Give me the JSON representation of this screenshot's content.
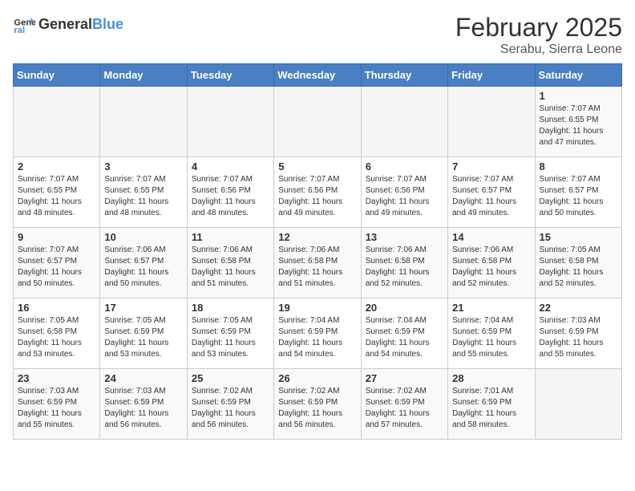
{
  "header": {
    "logo_general": "General",
    "logo_blue": "Blue",
    "month_year": "February 2025",
    "location": "Serabu, Sierra Leone"
  },
  "days_of_week": [
    "Sunday",
    "Monday",
    "Tuesday",
    "Wednesday",
    "Thursday",
    "Friday",
    "Saturday"
  ],
  "weeks": [
    [
      {
        "day": "",
        "sunrise": "",
        "sunset": "",
        "daylight": ""
      },
      {
        "day": "",
        "sunrise": "",
        "sunset": "",
        "daylight": ""
      },
      {
        "day": "",
        "sunrise": "",
        "sunset": "",
        "daylight": ""
      },
      {
        "day": "",
        "sunrise": "",
        "sunset": "",
        "daylight": ""
      },
      {
        "day": "",
        "sunrise": "",
        "sunset": "",
        "daylight": ""
      },
      {
        "day": "",
        "sunrise": "",
        "sunset": "",
        "daylight": ""
      },
      {
        "day": "1",
        "sunrise": "Sunrise: 7:07 AM",
        "sunset": "Sunset: 6:55 PM",
        "daylight": "Daylight: 11 hours and 47 minutes."
      }
    ],
    [
      {
        "day": "2",
        "sunrise": "Sunrise: 7:07 AM",
        "sunset": "Sunset: 6:55 PM",
        "daylight": "Daylight: 11 hours and 48 minutes."
      },
      {
        "day": "3",
        "sunrise": "Sunrise: 7:07 AM",
        "sunset": "Sunset: 6:55 PM",
        "daylight": "Daylight: 11 hours and 48 minutes."
      },
      {
        "day": "4",
        "sunrise": "Sunrise: 7:07 AM",
        "sunset": "Sunset: 6:56 PM",
        "daylight": "Daylight: 11 hours and 48 minutes."
      },
      {
        "day": "5",
        "sunrise": "Sunrise: 7:07 AM",
        "sunset": "Sunset: 6:56 PM",
        "daylight": "Daylight: 11 hours and 49 minutes."
      },
      {
        "day": "6",
        "sunrise": "Sunrise: 7:07 AM",
        "sunset": "Sunset: 6:56 PM",
        "daylight": "Daylight: 11 hours and 49 minutes."
      },
      {
        "day": "7",
        "sunrise": "Sunrise: 7:07 AM",
        "sunset": "Sunset: 6:57 PM",
        "daylight": "Daylight: 11 hours and 49 minutes."
      },
      {
        "day": "8",
        "sunrise": "Sunrise: 7:07 AM",
        "sunset": "Sunset: 6:57 PM",
        "daylight": "Daylight: 11 hours and 50 minutes."
      }
    ],
    [
      {
        "day": "9",
        "sunrise": "Sunrise: 7:07 AM",
        "sunset": "Sunset: 6:57 PM",
        "daylight": "Daylight: 11 hours and 50 minutes."
      },
      {
        "day": "10",
        "sunrise": "Sunrise: 7:06 AM",
        "sunset": "Sunset: 6:57 PM",
        "daylight": "Daylight: 11 hours and 50 minutes."
      },
      {
        "day": "11",
        "sunrise": "Sunrise: 7:06 AM",
        "sunset": "Sunset: 6:58 PM",
        "daylight": "Daylight: 11 hours and 51 minutes."
      },
      {
        "day": "12",
        "sunrise": "Sunrise: 7:06 AM",
        "sunset": "Sunset: 6:58 PM",
        "daylight": "Daylight: 11 hours and 51 minutes."
      },
      {
        "day": "13",
        "sunrise": "Sunrise: 7:06 AM",
        "sunset": "Sunset: 6:58 PM",
        "daylight": "Daylight: 11 hours and 52 minutes."
      },
      {
        "day": "14",
        "sunrise": "Sunrise: 7:06 AM",
        "sunset": "Sunset: 6:58 PM",
        "daylight": "Daylight: 11 hours and 52 minutes."
      },
      {
        "day": "15",
        "sunrise": "Sunrise: 7:05 AM",
        "sunset": "Sunset: 6:58 PM",
        "daylight": "Daylight: 11 hours and 52 minutes."
      }
    ],
    [
      {
        "day": "16",
        "sunrise": "Sunrise: 7:05 AM",
        "sunset": "Sunset: 6:58 PM",
        "daylight": "Daylight: 11 hours and 53 minutes."
      },
      {
        "day": "17",
        "sunrise": "Sunrise: 7:05 AM",
        "sunset": "Sunset: 6:59 PM",
        "daylight": "Daylight: 11 hours and 53 minutes."
      },
      {
        "day": "18",
        "sunrise": "Sunrise: 7:05 AM",
        "sunset": "Sunset: 6:59 PM",
        "daylight": "Daylight: 11 hours and 53 minutes."
      },
      {
        "day": "19",
        "sunrise": "Sunrise: 7:04 AM",
        "sunset": "Sunset: 6:59 PM",
        "daylight": "Daylight: 11 hours and 54 minutes."
      },
      {
        "day": "20",
        "sunrise": "Sunrise: 7:04 AM",
        "sunset": "Sunset: 6:59 PM",
        "daylight": "Daylight: 11 hours and 54 minutes."
      },
      {
        "day": "21",
        "sunrise": "Sunrise: 7:04 AM",
        "sunset": "Sunset: 6:59 PM",
        "daylight": "Daylight: 11 hours and 55 minutes."
      },
      {
        "day": "22",
        "sunrise": "Sunrise: 7:03 AM",
        "sunset": "Sunset: 6:59 PM",
        "daylight": "Daylight: 11 hours and 55 minutes."
      }
    ],
    [
      {
        "day": "23",
        "sunrise": "Sunrise: 7:03 AM",
        "sunset": "Sunset: 6:59 PM",
        "daylight": "Daylight: 11 hours and 55 minutes."
      },
      {
        "day": "24",
        "sunrise": "Sunrise: 7:03 AM",
        "sunset": "Sunset: 6:59 PM",
        "daylight": "Daylight: 11 hours and 56 minutes."
      },
      {
        "day": "25",
        "sunrise": "Sunrise: 7:02 AM",
        "sunset": "Sunset: 6:59 PM",
        "daylight": "Daylight: 11 hours and 56 minutes."
      },
      {
        "day": "26",
        "sunrise": "Sunrise: 7:02 AM",
        "sunset": "Sunset: 6:59 PM",
        "daylight": "Daylight: 11 hours and 56 minutes."
      },
      {
        "day": "27",
        "sunrise": "Sunrise: 7:02 AM",
        "sunset": "Sunset: 6:59 PM",
        "daylight": "Daylight: 11 hours and 57 minutes."
      },
      {
        "day": "28",
        "sunrise": "Sunrise: 7:01 AM",
        "sunset": "Sunset: 6:59 PM",
        "daylight": "Daylight: 11 hours and 58 minutes."
      },
      {
        "day": "",
        "sunrise": "",
        "sunset": "",
        "daylight": ""
      }
    ]
  ]
}
